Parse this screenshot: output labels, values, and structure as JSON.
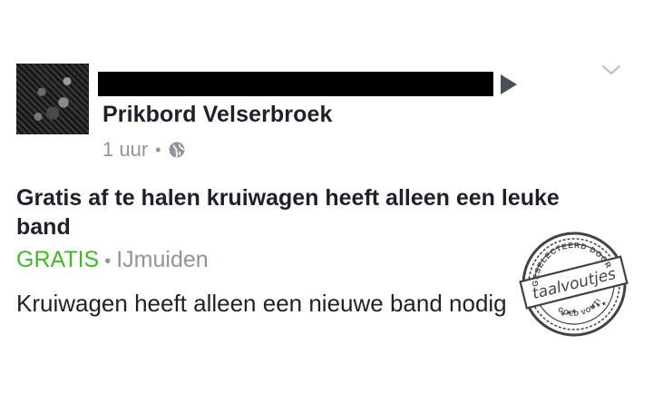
{
  "post": {
    "group_name": "Prikbord Velserbroek",
    "timestamp": "1 uur",
    "separator": "•",
    "privacy_icon": "globe-icon",
    "menu_icon": "chevron-down-icon",
    "share_arrow_icon": "play-arrow-icon",
    "author_redacted": true
  },
  "listing": {
    "title": "Gratis af te halen kruiwagen heeft alleen een leuke band",
    "price": "GRATIS",
    "separator": "•",
    "location": "IJmuiden",
    "description": "Kruiwagen heeft alleen een nieuwe band nodig"
  },
  "stamp": {
    "top_text": "GESELECTEERD DOOR",
    "brand": "taalvoutjes",
    "bottom_text": "GOED VOUT!",
    "color": "#333333"
  },
  "colors": {
    "price": "#42b72a",
    "meta": "#90949c",
    "text": "#1d2129",
    "redaction": "#000000"
  }
}
